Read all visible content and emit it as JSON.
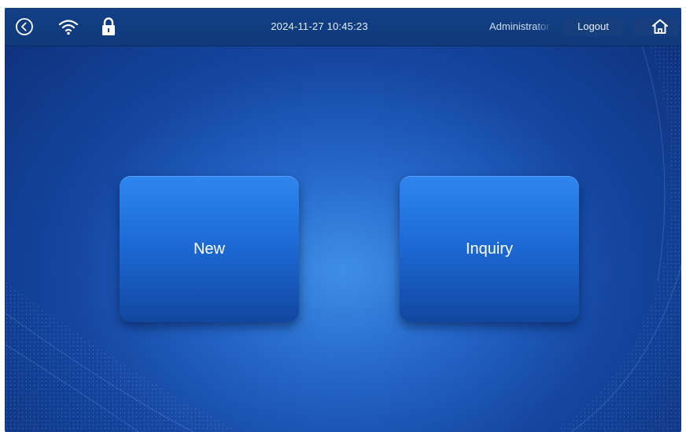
{
  "statusbar": {
    "datetime": "2024-11-27 10:45:23",
    "user": "Administrator",
    "logout_label": "Logout",
    "icons": [
      "back-icon",
      "wifi-icon",
      "lock-icon",
      "home-icon"
    ]
  },
  "main": {
    "new_label": "New",
    "inquiry_label": "Inquiry"
  },
  "colors": {
    "background_dark": "#0d2f78",
    "background_light": "#3f8fe6",
    "statusbar": "#123f85",
    "tile": "#1d6bd6"
  }
}
